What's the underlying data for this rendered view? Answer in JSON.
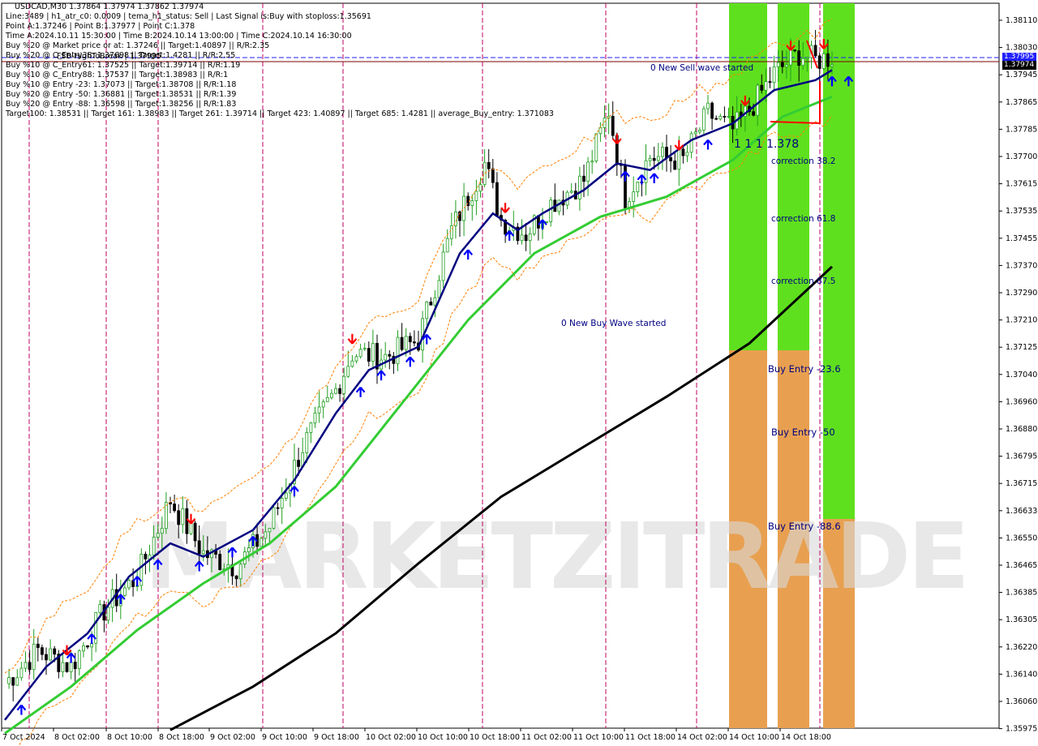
{
  "header": {
    "symbol_line": "USDCAD,M30  1.37864 1.37974 1.37862 1.37974",
    "lines": [
      "Line:3489  |  h1_atr_c0: 0.0009  |  tema_h1_status: Sell  |  Last Signal is:Buy with stoploss:1.35691",
      "Point A:1.37246  |  Point B:1.37977  |  Point C:1.378",
      "Time A:2024.10.11 15:30:00  |  Time B:2024.10.14 13:00:00  |  Time C:2024.10.14 16:30:00",
      "Buy %20 @ Market price or at: 1.37246  ||  Target:1.40897  ||  R/R:2.35",
      "Buy %20 @ C_Entry38: 1.37698  ||  Target:1.4281  ||  R/R:2.55",
      "Buy %10 @ C_Entry61: 1.37525  ||  Target:1.39714  ||  R/R:1.19",
      "Buy %10 @ C_Entry88: 1.37537  ||  Target:1.38983  ||  R/R:1",
      "Buy %10 @ Entry -23: 1.37073  ||  Target:1.38708  ||  R/R:1.18",
      "Buy %20 @ Entry -50: 1.36881  ||  Target:1.38531  ||  R/R:1.39",
      "Buy %20 @ Entry -88: 1.36598  ||  Target:1.38256  ||  R/R:1.83",
      "Target100: 1.38531  ||  Target 161: 1.38983  ||  Target 261: 1.39714  ||  Target 423: 1.40897  ||  Target 685: 1.4281  ||  average_Buy_entry: 1.371083"
    ],
    "fsb_label": "FSB-HighToBreak | 1.37995"
  },
  "chart_labels": {
    "sell_wave": "0 New Sell wave started",
    "buy_wave": "0 New Buy Wave started",
    "point_c_value": "1 1 1 1.378",
    "correction_382": "correction 38.2",
    "correction_618": "correction 61.8",
    "correction_875": "correction 87.5",
    "buy_entry_236": "Buy Entry -23.6",
    "buy_entry_50": "Buy Entry -50",
    "buy_entry_886": "Buy Entry -88.6",
    "watermark": "MARKETZITRADE"
  },
  "price_tags": {
    "high_line": "1.37995",
    "current": "1.37974"
  },
  "colors": {
    "bull": "#1f9e1f",
    "bear": "#000000",
    "tema": "#000080",
    "ma_green": "#33cc33",
    "ma_black": "#000000",
    "band": "#ff7f00",
    "arrow_up": "#0000ff",
    "arrow_down": "#ff0000",
    "zone_green": "#5fe01e",
    "zone_orange": "#e8a050",
    "vline": "#c00060",
    "hline_blue": "#2020ff"
  },
  "chart_data": {
    "type": "candlestick",
    "symbol": "USDCAD",
    "timeframe": "M30",
    "y_ticks": [
      "1.38110",
      "1.38030",
      "1.37945",
      "1.37865",
      "1.37785",
      "1.37700",
      "1.37615",
      "1.37535",
      "1.37455",
      "1.37370",
      "1.37290",
      "1.37210",
      "1.37125",
      "1.37040",
      "1.36960",
      "1.36880",
      "1.36795",
      "1.36715",
      "1.36633",
      "1.36550",
      "1.36465",
      "1.36385",
      "1.36305",
      "1.36220",
      "1.36140",
      "1.36060",
      "1.35975"
    ],
    "ylim": [
      1.35975,
      1.3815
    ],
    "x_ticks": [
      "7 Oct 2024",
      "8 Oct 02:00",
      "8 Oct 10:00",
      "8 Oct 18:00",
      "9 Oct 02:00",
      "9 Oct 10:00",
      "9 Oct 18:00",
      "10 Oct 02:00",
      "10 Oct 10:00",
      "10 Oct 18:00",
      "11 Oct 02:00",
      "11 Oct 10:00",
      "11 Oct 18:00",
      "14 Oct 02:00",
      "14 Oct 10:00",
      "14 Oct 18:00"
    ],
    "bars": 200,
    "price_path": [
      [
        0,
        1.3609
      ],
      [
        8,
        1.3619
      ],
      [
        16,
        1.3614
      ],
      [
        24,
        1.3631
      ],
      [
        32,
        1.3641
      ],
      [
        40,
        1.3664
      ],
      [
        48,
        1.3648
      ],
      [
        56,
        1.3644
      ],
      [
        64,
        1.3656
      ],
      [
        72,
        1.368
      ],
      [
        80,
        1.3697
      ],
      [
        84,
        1.3708
      ],
      [
        92,
        1.3707
      ],
      [
        100,
        1.3712
      ],
      [
        108,
        1.3745
      ],
      [
        116,
        1.3765
      ],
      [
        120,
        1.3748
      ],
      [
        126,
        1.3744
      ],
      [
        132,
        1.3753
      ],
      [
        140,
        1.376
      ],
      [
        146,
        1.3781
      ],
      [
        150,
        1.3755
      ],
      [
        156,
        1.3767
      ],
      [
        164,
        1.3766
      ],
      [
        170,
        1.378
      ],
      [
        176,
        1.3775
      ],
      [
        180,
        1.3781
      ],
      [
        186,
        1.3792
      ],
      [
        192,
        1.3798
      ],
      [
        196,
        1.3796
      ],
      [
        200,
        1.3797
      ]
    ],
    "tema_path": [
      [
        0,
        1.3598
      ],
      [
        10,
        1.3614
      ],
      [
        20,
        1.3624
      ],
      [
        30,
        1.3641
      ],
      [
        40,
        1.3651
      ],
      [
        48,
        1.3647
      ],
      [
        60,
        1.3655
      ],
      [
        70,
        1.367
      ],
      [
        80,
        1.369
      ],
      [
        88,
        1.3703
      ],
      [
        100,
        1.371
      ],
      [
        110,
        1.3738
      ],
      [
        118,
        1.375
      ],
      [
        124,
        1.3745
      ],
      [
        130,
        1.375
      ],
      [
        140,
        1.3757
      ],
      [
        148,
        1.3765
      ],
      [
        156,
        1.3763
      ],
      [
        166,
        1.3772
      ],
      [
        176,
        1.3777
      ],
      [
        186,
        1.3787
      ],
      [
        196,
        1.379
      ],
      [
        200,
        1.3793
      ]
    ],
    "ma_green_path": [
      [
        0,
        1.3594
      ],
      [
        16,
        1.3608
      ],
      [
        32,
        1.3625
      ],
      [
        48,
        1.3639
      ],
      [
        64,
        1.3651
      ],
      [
        80,
        1.3668
      ],
      [
        96,
        1.3693
      ],
      [
        112,
        1.3718
      ],
      [
        128,
        1.3738
      ],
      [
        144,
        1.3749
      ],
      [
        160,
        1.3755
      ],
      [
        176,
        1.3766
      ],
      [
        188,
        1.3779
      ],
      [
        200,
        1.3785
      ]
    ],
    "ma_black_path": [
      [
        40,
        1.3595
      ],
      [
        60,
        1.3608
      ],
      [
        80,
        1.3624
      ],
      [
        100,
        1.3645
      ],
      [
        120,
        1.3665
      ],
      [
        140,
        1.368
      ],
      [
        160,
        1.3695
      ],
      [
        180,
        1.3711
      ],
      [
        200,
        1.3734
      ]
    ],
    "up_arrow_bars": [
      4,
      16,
      21,
      28,
      32,
      37,
      47,
      55,
      60,
      70,
      86,
      91,
      98,
      102,
      112,
      122,
      130,
      150,
      154,
      157,
      170,
      200,
      204
    ],
    "down_arrow_bars": [
      15,
      45,
      84,
      121,
      148,
      163,
      179,
      190,
      198
    ],
    "zones": [
      {
        "from": 1.3812,
        "to": 1.3712,
        "color": "green"
      },
      {
        "from": 1.3712,
        "to": 1.3597,
        "color": "orange"
      }
    ]
  }
}
